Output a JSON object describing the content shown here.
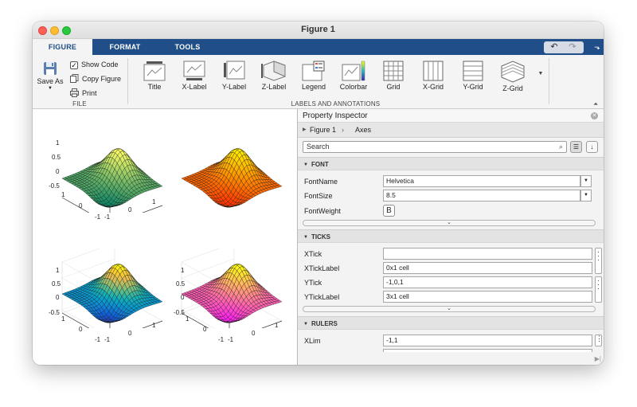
{
  "window": {
    "title": "Figure 1"
  },
  "tabs": [
    {
      "label": "FIGURE",
      "active": true
    },
    {
      "label": "FORMAT",
      "active": false
    },
    {
      "label": "TOOLS",
      "active": false
    }
  ],
  "quick_access": {
    "undo_icon": "undo-icon",
    "redo_icon": "redo-icon"
  },
  "toolstrip": {
    "file_section": {
      "label": "FILE",
      "save_as": "Save As",
      "show_code": "Show Code",
      "show_code_checked": true,
      "copy_figure": "Copy Figure",
      "print": "Print"
    },
    "labels_section": {
      "label": "LABELS AND ANNOTATIONS",
      "items": [
        "Title",
        "X-Label",
        "Y-Label",
        "Z-Label",
        "Legend",
        "Colorbar",
        "Grid",
        "X-Grid",
        "Y-Grid",
        "Z-Grid"
      ]
    }
  },
  "figure": {
    "plots": [
      {
        "colormap": "summer",
        "show_grid": false,
        "zticks": [
          "1",
          "0.5",
          "0",
          "-0.5"
        ],
        "yticks": [
          "1",
          "0",
          "-1"
        ],
        "xticks": [
          "-1",
          "0",
          "1"
        ]
      },
      {
        "colormap": "autumn",
        "show_grid": false,
        "axes_visible": false
      },
      {
        "colormap": "parula",
        "show_grid": true,
        "zticks": [
          "1",
          "0.5",
          "0",
          "-0.5"
        ],
        "yticks": [
          "1",
          "0",
          "-1"
        ],
        "xticks": [
          "-1",
          "0",
          "1"
        ]
      },
      {
        "colormap": "spring",
        "show_grid": true,
        "zticks": [
          "1",
          "0.5",
          "0",
          "-0.5"
        ],
        "yticks": [
          "1",
          "0",
          "-1"
        ],
        "xticks": [
          "-1",
          "0",
          "1"
        ]
      }
    ]
  },
  "inspector": {
    "title": "Property Inspector",
    "breadcrumb": [
      "Figure 1",
      "Axes"
    ],
    "search_placeholder": "Search",
    "groups": {
      "font": {
        "label": "FONT",
        "props": [
          {
            "name": "FontName",
            "value": "Helvetica"
          },
          {
            "name": "FontSize",
            "value": "8.5"
          },
          {
            "name": "FontWeight",
            "value": "B"
          }
        ]
      },
      "ticks": {
        "label": "TICKS",
        "props": [
          {
            "name": "XTick",
            "value": ""
          },
          {
            "name": "XTickLabel",
            "value": "0x1 cell"
          },
          {
            "name": "YTick",
            "value": "-1,0,1"
          },
          {
            "name": "YTickLabel",
            "value": "3x1 cell"
          }
        ]
      },
      "rulers": {
        "label": "RULERS",
        "props": [
          {
            "name": "XLim",
            "value": "-1,1"
          }
        ]
      }
    }
  },
  "colors": {
    "tab_bar": "#1f4e88",
    "accent": "#1f4e88"
  }
}
